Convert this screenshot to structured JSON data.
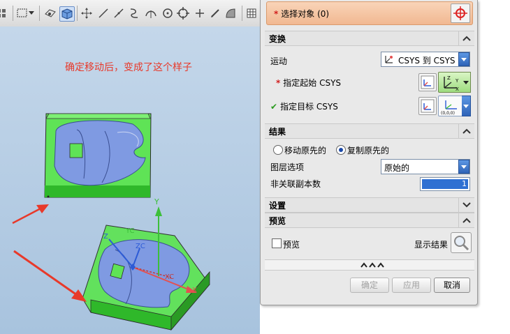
{
  "annotation": "确定移动后，变成了这个样子",
  "selection": {
    "label": "选择对象 (0)"
  },
  "sections": {
    "transform": "变换",
    "result": "结果",
    "settings": "设置",
    "preview": "预览"
  },
  "transform": {
    "motion_label": "运动",
    "motion_value": "CSYS 到 CSYS",
    "start_csys_label": "指定起始 CSYS",
    "target_csys_label": "指定目标 CSYS"
  },
  "result": {
    "move_original": "移动原先的",
    "copy_original": "复制原先的",
    "layer_label": "图层选项",
    "layer_value": "原始的",
    "copies_label": "非关联副本数",
    "copies_value": "1"
  },
  "preview": {
    "preview_label": "预览",
    "show_result_label": "显示结果"
  },
  "buttons": {
    "ok": "确定",
    "apply": "应用",
    "cancel": "取消"
  },
  "scene_labels": {
    "y_axis": "Y",
    "x_axis": "X",
    "xc": "XC",
    "yc": "YC",
    "zc": "ZC",
    "z": "Z"
  },
  "colors": {
    "accent_orange": "#f1b891",
    "part_green": "#58e04e",
    "arrow_red": "#e8392a"
  },
  "icons": [
    "grid-icon",
    "select-rect-icon",
    "dropdown-icon",
    "view-icon",
    "cube-icon",
    "move-icon",
    "line-icon",
    "line2-icon",
    "spline-icon",
    "arc-icon",
    "circle-icon",
    "target-icon",
    "plus-icon",
    "pen-icon",
    "fill-icon",
    "table-icon"
  ]
}
